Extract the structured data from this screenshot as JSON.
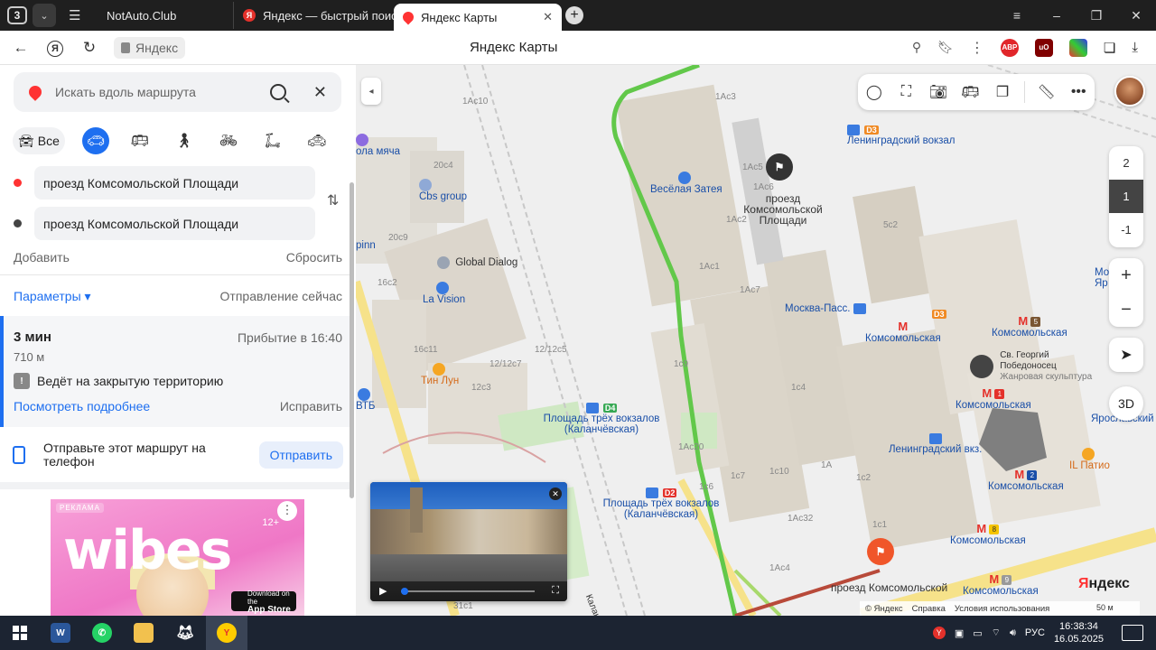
{
  "browser": {
    "tab_count": "3",
    "tabs": [
      {
        "title": "NotAuto.Club"
      },
      {
        "title": "Яндекс — быстрый поиск"
      },
      {
        "title": "Яндекс Карты"
      }
    ],
    "site_chip": "Яндекс",
    "page_title": "Яндекс Карты",
    "extensions": [
      {
        "name": "adblock-plus-icon",
        "color": "#e1262a",
        "label": "ABP"
      },
      {
        "name": "ublock-icon",
        "color": "#800000",
        "label": "uO"
      }
    ]
  },
  "panel": {
    "search_placeholder": "Искать вдоль маршрута",
    "modes": {
      "all_label": "Все",
      "active": "car"
    },
    "from": "проезд Комсомольской Площади",
    "to": "проезд Комсомольской Площади",
    "add_label": "Добавить",
    "reset_label": "Сбросить",
    "params_label": "Параметры ▾",
    "departure_label": "Отправление сейчас",
    "route": {
      "duration": "3 мин",
      "arrival": "Прибытие в 16:40",
      "distance": "710 м",
      "warning": "Ведёт на закрытую территорию",
      "details_link": "Посмотреть подробнее",
      "fix_link": "Исправить"
    },
    "send": {
      "text": "Отправьте этот маршрут на телефон",
      "button": "Отправить"
    },
    "ad": {
      "label": "РЕКЛАМА",
      "brand": "wibes",
      "age": "12+",
      "store_small": "Download on the",
      "store_big": "App Store"
    }
  },
  "map": {
    "labels": {
      "leningradsky_station": "Ленинградский вокзал",
      "vesyolaya_zateya": "Весёлая Затея",
      "proezd": "проезд Комсомольской Площади",
      "global_dialog": "Global Dialog",
      "la_vision": "La Vision",
      "cbs_group": "Cbs group",
      "tin_lun": "Тин Лун",
      "vtb": "ВТБ",
      "ploshchad_d4": "Площадь трёх вокзалов (Каланчёвская)",
      "ploshchad_d2": "Площадь трёх вокзалов (Каланчёвская)",
      "moskva_pass": "Москва-Пасс.",
      "komsomolskaya": "Комсомольская",
      "leningradsky_vkz": "Ленинградский вкз.",
      "yaroslavsky": "Ярославский",
      "st_george": "Св. Георгий Победоносец",
      "st_george_sub": "Жанровая скульптура",
      "il_patio": "IL Патио",
      "kalanchevskaya_street": "Каланчёвская",
      "myasa": "ола мяча",
      "pinn": "pinn",
      "mo": "Мо",
      "yar": "Яр",
      "proezd_bottom": "проезд Комсомольской"
    },
    "buildings": [
      "1Ас10",
      "1Ас3",
      "1Ас5",
      "1Ас6",
      "1Ас2",
      "1Ас1",
      "1Ас7",
      "1с9",
      "1с4",
      "1Ас20",
      "1с10",
      "1А",
      "1с7",
      "1с6",
      "1с2",
      "1Ас32",
      "1с1",
      "1Ас4",
      "5с2",
      "20с4",
      "20с9",
      "16с2",
      "16с11",
      "12/12с5",
      "12/12с7",
      "12с3",
      "31с1"
    ],
    "line_tags": [
      {
        "label": "D3",
        "color": "#f08a24"
      },
      {
        "label": "D4",
        "color": "#36a853"
      },
      {
        "label": "D2",
        "color": "#e4312b"
      }
    ],
    "metro_lines": [
      "5",
      "1",
      "2",
      "8",
      "9"
    ],
    "floors": [
      "2",
      "1",
      "-1"
    ],
    "active_floor": "1",
    "zoom_in": "+",
    "zoom_out": "−",
    "btn_3d": "3D",
    "logo_prefix": "Я",
    "logo_rest": "ндекс",
    "scale": "50 м",
    "attribution": [
      "© Яндекс",
      "Справка",
      "Условия использования"
    ]
  },
  "taskbar": {
    "apps": [
      {
        "name": "word-icon",
        "color": "#2b579a",
        "label": "W"
      },
      {
        "name": "whatsapp-icon",
        "color": "#25d366",
        "label": ""
      },
      {
        "name": "file-explorer-icon",
        "color": "#f2c14e",
        "label": ""
      },
      {
        "name": "fox-app-icon",
        "color": "#2e3440",
        "label": ""
      },
      {
        "name": "yandex-browser-icon",
        "color": "#ffcc00",
        "label": ""
      }
    ],
    "lang": "РУС",
    "time": "16:38:34",
    "date": "16.05.2025"
  }
}
